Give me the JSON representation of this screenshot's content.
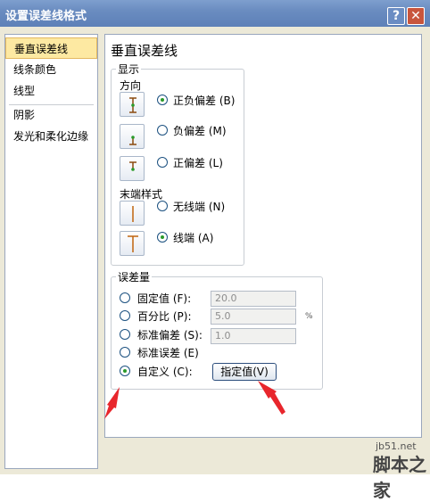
{
  "window": {
    "title": "设置误差线格式",
    "help_glyph": "?",
    "close_glyph": "✕",
    "accent": "#5d80b8"
  },
  "sidebar": {
    "items": [
      {
        "label": "垂直误差线",
        "selected": true
      },
      {
        "label": "线条颜色",
        "selected": false
      },
      {
        "label": "线型",
        "selected": false
      },
      {
        "label": "阴影",
        "selected": false
      },
      {
        "label": "发光和柔化边缘",
        "selected": false
      }
    ]
  },
  "main": {
    "title": "垂直误差线"
  },
  "display": {
    "legend": "显示",
    "direction_label": "方向",
    "direction_options": [
      {
        "label": "正负偏差",
        "key": "(B)",
        "selected": true,
        "icon": "both-error-bar-icon"
      },
      {
        "label": "负偏差",
        "key": "(M)",
        "selected": false,
        "icon": "minus-error-bar-icon"
      },
      {
        "label": "正偏差",
        "key": "(L)",
        "selected": false,
        "icon": "plus-error-bar-icon"
      }
    ],
    "end_style_label": "末端样式",
    "end_style_options": [
      {
        "label": "无线端",
        "key": "(N)",
        "selected": false,
        "icon": "no-cap-icon"
      },
      {
        "label": "线端",
        "key": "(A)",
        "selected": true,
        "icon": "cap-icon"
      }
    ]
  },
  "error_amount": {
    "legend": "误差量",
    "options": [
      {
        "label": "固定值",
        "key": "(F)",
        "selected": false,
        "value": "20.0"
      },
      {
        "label": "百分比",
        "key": "(P)",
        "selected": false,
        "value": "5.0",
        "unit": "%"
      },
      {
        "label": "标准偏差",
        "key": "(S)",
        "selected": false,
        "value": "1.0"
      },
      {
        "label": "标准误差",
        "key": "(E)",
        "selected": false
      },
      {
        "label": "自定义",
        "key": "(C)",
        "selected": true
      }
    ],
    "specify_button": "指定值(V)"
  },
  "watermark": {
    "site": "jb51.net",
    "brand": "脚本之家"
  },
  "colors": {
    "selection": "#fde9a2",
    "radio_dot": "#2a9a2a",
    "annotation_arrow": "#e8262c"
  }
}
